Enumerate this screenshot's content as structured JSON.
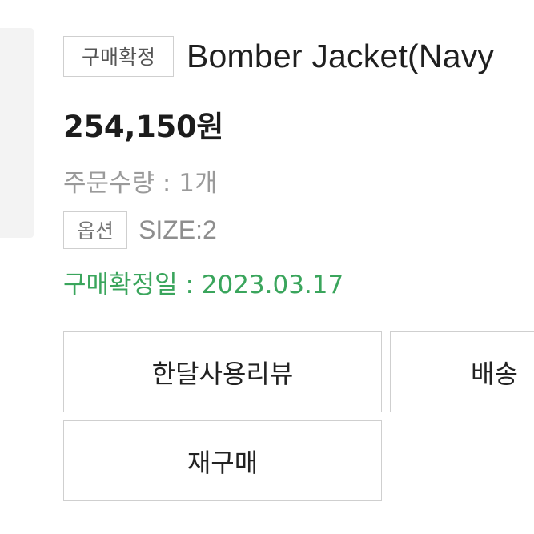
{
  "order": {
    "status_tag": "구매확정",
    "product_name": "Bomber Jacket(Navy",
    "price": "254,150원",
    "quantity": "주문수량 : 1개",
    "option_tag": "옵션",
    "option_value": "SIZE:2",
    "confirm_date": "구매확정일 : 2023.03.17"
  },
  "actions": {
    "review_label": "한달사용리뷰",
    "shipping_label": "배송",
    "rebuy_label": "재구매"
  },
  "colors": {
    "accent_green": "#3aa55c",
    "border": "#cfcfcf",
    "muted_text": "#9a9a9a"
  }
}
